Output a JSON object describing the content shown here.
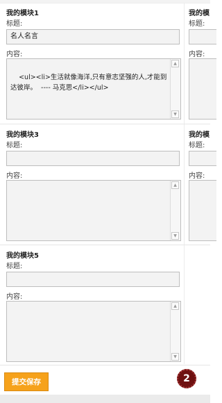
{
  "labels": {
    "title": "标题:",
    "content": "内容:"
  },
  "modules": [
    {
      "name": "我的模块1",
      "title_value": "名人名言",
      "content_value": "<ul><li>生活就像海洋,只有意志坚强的人,才能到达彼岸。  ---- 马克思</li></ul>"
    },
    {
      "name": "我的模",
      "title_value": "",
      "content_value": ""
    },
    {
      "name": "我的模块3",
      "title_value": "",
      "content_value": ""
    },
    {
      "name": "我的模",
      "title_value": "",
      "content_value": ""
    },
    {
      "name": "我的模块5",
      "title_value": "",
      "content_value": ""
    }
  ],
  "scroll": {
    "up_glyph": "▲",
    "down_glyph": "▼"
  },
  "actions": {
    "submit_label": "提交保存"
  },
  "step_badge": "2"
}
